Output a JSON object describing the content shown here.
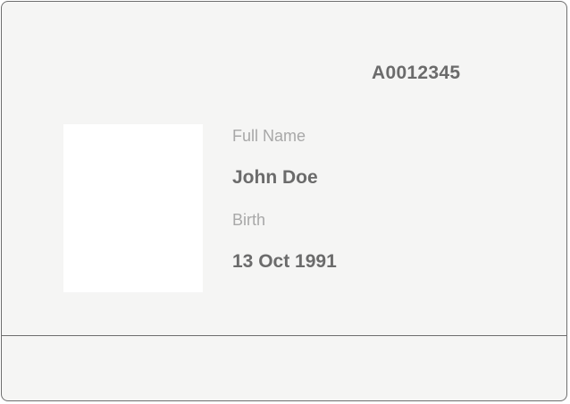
{
  "card": {
    "id_number": "A0012345",
    "fields": {
      "full_name_label": "Full Name",
      "full_name_value": "John Doe",
      "birth_label": "Birth",
      "birth_value": "13 Oct 1991"
    }
  },
  "colors": {
    "card_background": "#f5f5f4",
    "card_border": "#6e6e6e",
    "label_text": "#a8a8a8",
    "value_text": "#6b6b6b",
    "photo_placeholder": "#ffffff"
  }
}
